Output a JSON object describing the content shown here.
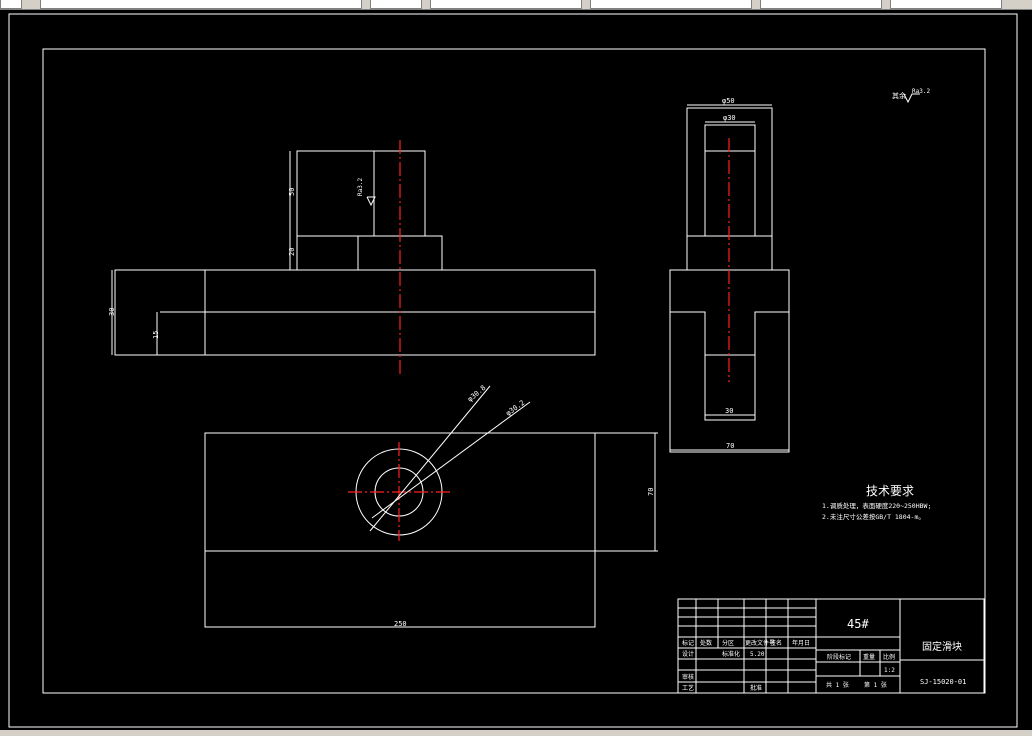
{
  "drawing": {
    "surface_roughness_note": "Ra3.2",
    "views": {
      "front": {
        "dim_height_top": "50",
        "dim_height_mid": "20",
        "dim_left_total": "30",
        "dim_left_inner": "15",
        "roughness": "Ra3.2"
      },
      "side": {
        "dim_top_outer": "φ50",
        "dim_top_inner": "φ30",
        "dim_slot": "30",
        "dim_width": "70"
      },
      "top": {
        "dim_hole_outer": "φ30.8",
        "dim_hole_inner": "φ30.2",
        "dim_height": "70",
        "dim_length": "250"
      }
    },
    "technical_requirements": {
      "title": "技术要求",
      "items": [
        "1.调质处理，表面硬度220~250HBW;",
        "2.未注尺寸公差按GB/T 1804-m。"
      ]
    },
    "title_block": {
      "material": "45#",
      "part_name": "固定滑块",
      "drawing_number": "SJ-15020-01",
      "scale": "1:2",
      "headers": [
        "标记",
        "处数",
        "分区",
        "更改文件号",
        "签名",
        "年月日"
      ],
      "rows": [
        "设计",
        "审核",
        "工艺",
        "批准"
      ],
      "stage_mark": "阶段标记",
      "weight": "重量",
      "ratio": "比例",
      "sheets": "共 1 张",
      "sheet_no": "第 1 张",
      "standardize": "标准化",
      "date": "5.20"
    }
  },
  "colors": {
    "background": "#000000",
    "lines": "#ffffff",
    "centerline": "#ff2020"
  }
}
